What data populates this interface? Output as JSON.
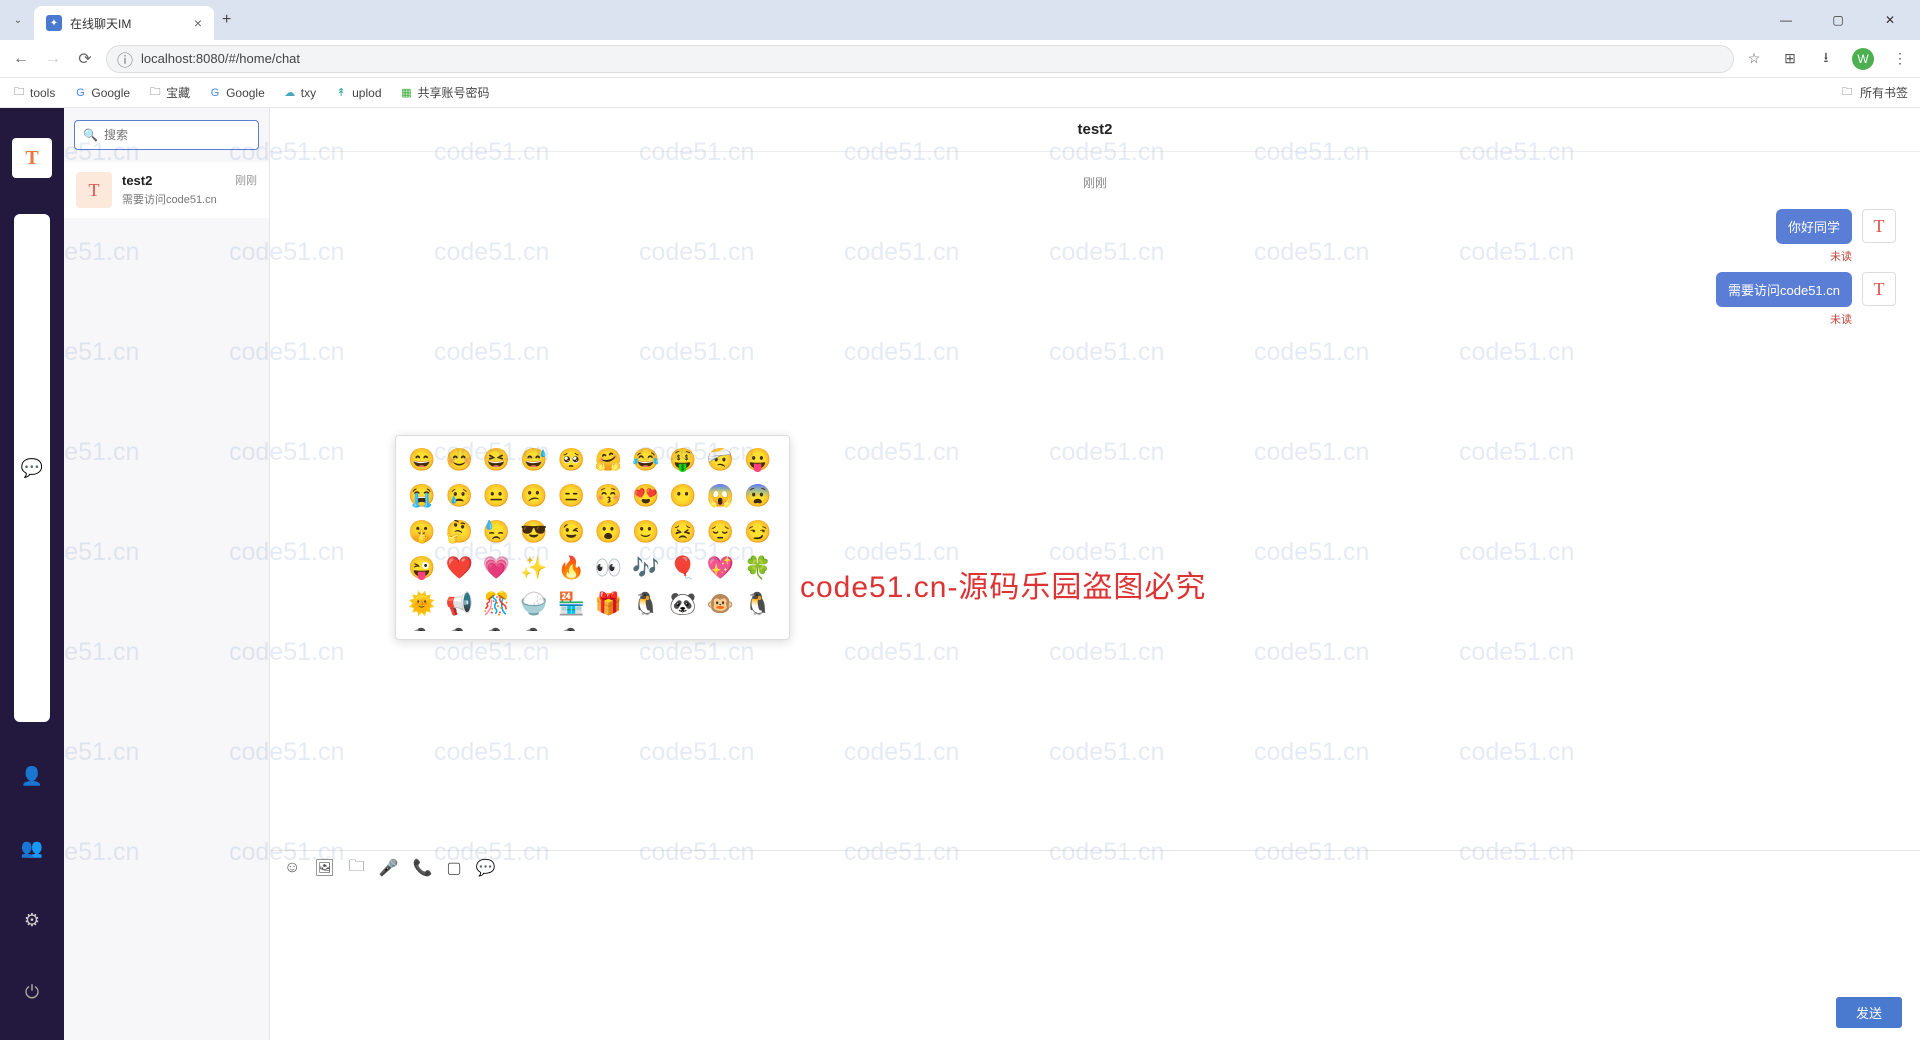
{
  "browser": {
    "tab_title": "在线聊天IM",
    "new_tab": "+",
    "url": "localhost:8080/#/home/chat",
    "profile_initial": "W",
    "bookmarks": [
      "tools",
      "Google",
      "宝藏",
      "Google",
      "txy",
      "uplod",
      "共享账号密码"
    ],
    "all_bookmarks": "所有书签"
  },
  "rail": {
    "avatar_letter": "T"
  },
  "search": {
    "placeholder": "搜索"
  },
  "conversations": [
    {
      "avatar": "T",
      "name": "test2",
      "time": "刚刚",
      "last": "需要访问code51.cn"
    }
  ],
  "chat": {
    "title": "test2",
    "time_divider": "刚刚",
    "messages": [
      {
        "text": "你好同学",
        "status": "未读",
        "avatar": "T"
      },
      {
        "text": "需要访问code51.cn",
        "status": "未读",
        "avatar": "T"
      }
    ],
    "send_label": "发送"
  },
  "emoji": {
    "list": [
      "😄",
      "😊",
      "😆",
      "😅",
      "🥺",
      "🤗",
      "😂",
      "🤑",
      "🤕",
      "😛",
      "😭",
      "😢",
      "😐",
      "😕",
      "😑",
      "😚",
      "😍",
      "😶",
      "😱",
      "😨",
      "🤫",
      "🤔",
      "😓",
      "😎",
      "😉",
      "😮",
      "🙂",
      "😣",
      "😔",
      "😏",
      "😜",
      "❤️",
      "💗",
      "✨",
      "🔥",
      "👀",
      "🎶",
      "🎈",
      "💖",
      "🍀",
      "🌞",
      "📢",
      "🎊",
      "🍚",
      "🏪",
      "🎁",
      "🐧",
      "🐼",
      "🐵",
      "🐧",
      "🐧",
      "🐧",
      "🐧",
      "🐧",
      "🐧"
    ]
  },
  "center_watermark": "code51.cn-源码乐园盗图必究",
  "wm_text": "code51.cn"
}
